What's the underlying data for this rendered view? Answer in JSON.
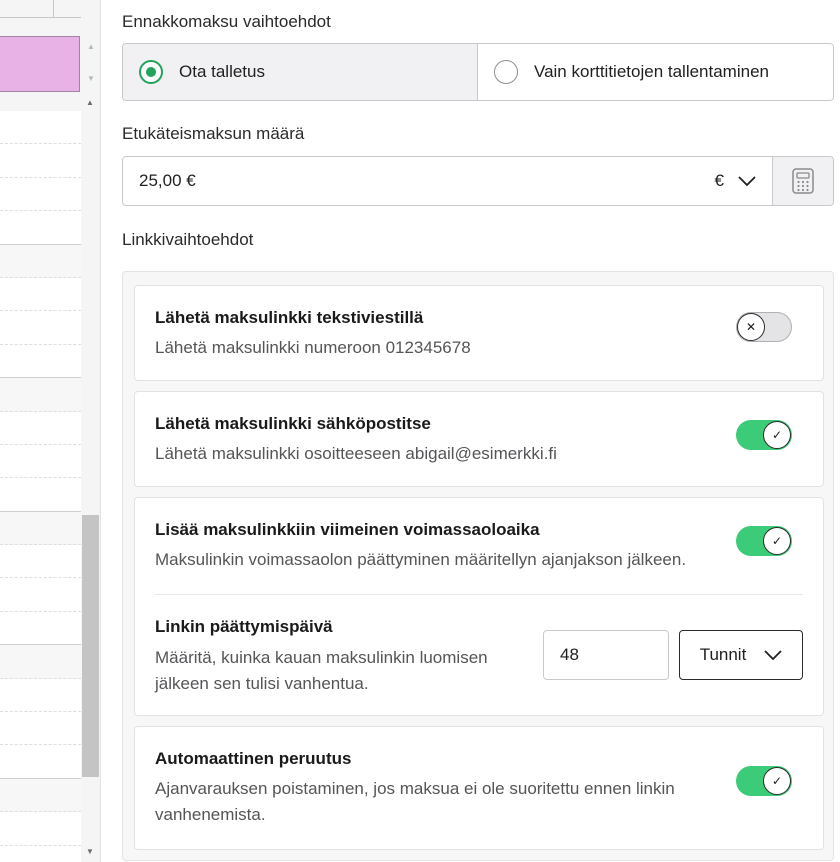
{
  "deposit_options": {
    "label": "Ennakkomaksu vaihtoehdot",
    "options": [
      {
        "label": "Ota talletus",
        "selected": true
      },
      {
        "label": "Vain korttitietojen tallentaminen",
        "selected": false
      }
    ]
  },
  "prepayment": {
    "label": "Etukäteismaksun määrä",
    "value": "25,00 €",
    "currency": "€",
    "calculator_icon": "calculator-icon"
  },
  "link_options": {
    "label": "Linkkivaihtoehdot",
    "sms": {
      "title": "Lähetä maksulinkki tekstiviestillä",
      "desc": "Lähetä maksulinkki numeroon 012345678",
      "enabled": false
    },
    "email": {
      "title": "Lähetä maksulinkki sähköpostitse",
      "desc": "Lähetä maksulinkki osoitteeseen abigail@esimerkki.fi",
      "enabled": true
    },
    "expiry": {
      "title": "Lisää maksulinkkiin viimeinen voimassaoloaika",
      "desc": "Maksulinkin voimassaolon päättyminen määritellyn ajanjakson jälkeen.",
      "enabled": true,
      "date_title": "Linkin päättymispäivä",
      "date_desc_line1": "Määritä, kuinka kauan maksulinkin luomisen",
      "date_desc_line2": "jälkeen sen tulisi vanhentua.",
      "amount": "48",
      "unit": "Tunnit"
    },
    "auto_cancel": {
      "title": "Automaattinen peruutus",
      "desc_line1": "Ajanvarauksen poistaminen, jos maksua ei ole suoritettu ennen linkin",
      "desc_line2": "vanhenemista.",
      "enabled": true
    }
  },
  "colors": {
    "accent_green": "#3ccb78",
    "radio_green": "#20a35a",
    "event_pink": "#e8b2e6"
  }
}
